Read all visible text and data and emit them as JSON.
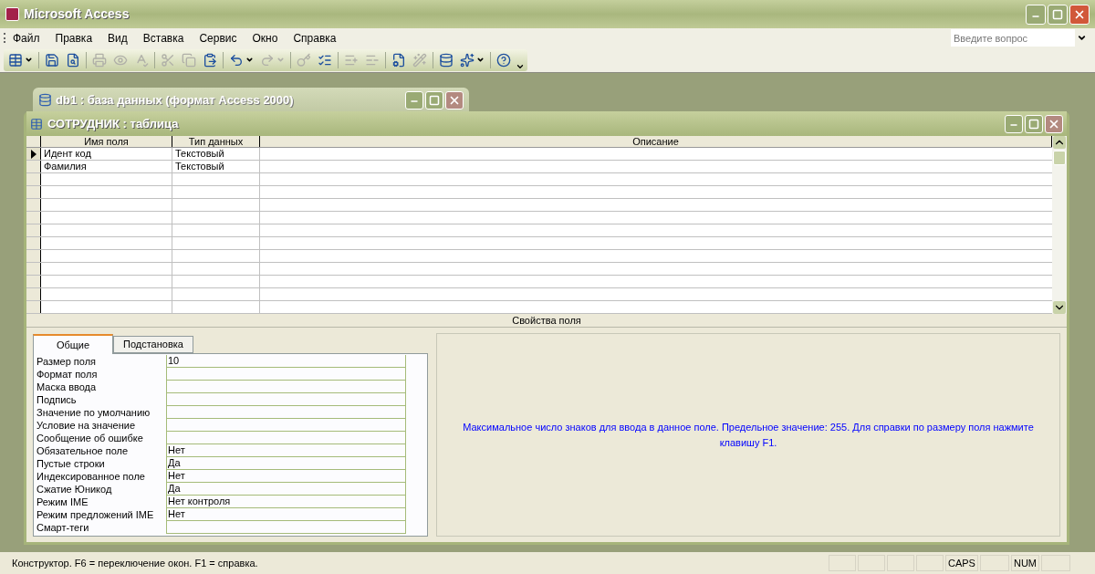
{
  "window": {
    "title": "Microsoft Access"
  },
  "menu": [
    "Файл",
    "Правка",
    "Вид",
    "Вставка",
    "Сервис",
    "Окно",
    "Справка"
  ],
  "question_box": {
    "placeholder": "Введите вопрос"
  },
  "toolbar": [
    {
      "kind": "view",
      "disabled": false
    },
    {
      "kind": "sep"
    },
    {
      "kind": "save",
      "disabled": false
    },
    {
      "kind": "search",
      "disabled": false
    },
    {
      "kind": "sep"
    },
    {
      "kind": "print",
      "disabled": true
    },
    {
      "kind": "preview",
      "disabled": true
    },
    {
      "kind": "spelling",
      "disabled": true
    },
    {
      "kind": "sep"
    },
    {
      "kind": "cut",
      "disabled": true
    },
    {
      "kind": "copy",
      "disabled": true
    },
    {
      "kind": "paste",
      "disabled": false
    },
    {
      "kind": "sep"
    },
    {
      "kind": "undo",
      "disabled": false
    },
    {
      "kind": "redo",
      "disabled": true
    },
    {
      "kind": "sep"
    },
    {
      "kind": "key",
      "disabled": true
    },
    {
      "kind": "builder",
      "disabled": false
    },
    {
      "kind": "sep"
    },
    {
      "kind": "insert_rows",
      "disabled": true
    },
    {
      "kind": "delete_rows",
      "disabled": true
    },
    {
      "kind": "sep"
    },
    {
      "kind": "properties",
      "disabled": false
    },
    {
      "kind": "build",
      "disabled": true
    },
    {
      "kind": "sep"
    },
    {
      "kind": "db_window",
      "disabled": false
    },
    {
      "kind": "new_object",
      "disabled": false
    },
    {
      "kind": "sep"
    },
    {
      "kind": "help",
      "disabled": false
    }
  ],
  "db_window": {
    "title": "db1 : база данных (формат Access 2000)"
  },
  "table_window": {
    "title": "СОТРУДНИК : таблица"
  },
  "design_grid": {
    "columns": [
      "Имя поля",
      "Тип данных",
      "Описание"
    ],
    "rows": [
      {
        "name": "Идент код",
        "type": "Текстовый",
        "selected": true
      },
      {
        "name": "Фамилия",
        "type": "Текстовый",
        "selected": false
      }
    ]
  },
  "field_properties": {
    "title": "Свойства поля",
    "tabs": [
      {
        "label": "Общие",
        "selected": true
      },
      {
        "label": "Подстановка",
        "selected": false
      }
    ],
    "properties": [
      {
        "label": "Размер поля",
        "value": "10"
      },
      {
        "label": "Формат поля"
      },
      {
        "label": "Маска ввода"
      },
      {
        "label": "Подпись"
      },
      {
        "label": "Значение по умолчанию"
      },
      {
        "label": "Условие на значение"
      },
      {
        "label": "Сообщение об ошибке"
      },
      {
        "label": "Обязательное поле",
        "value": "Нет"
      },
      {
        "label": "Пустые строки",
        "value": "Да"
      },
      {
        "label": "Индексированное поле",
        "value": "Нет"
      },
      {
        "label": "Сжатие Юникод",
        "value": "Да"
      },
      {
        "label": "Режим IME",
        "value": "Нет контроля"
      },
      {
        "label": "Режим предложений IME",
        "value": "Нет"
      },
      {
        "label": "Смарт-теги"
      }
    ],
    "help_text": "Максимальное число знаков для ввода в данное поле.  Предельное значение: 255.  Для справки по размеру поля нажмите клавишу F1."
  },
  "status_bar": {
    "message": "Конструктор.  F6 = переключение окон.  F1 = справка.",
    "indicators": [
      "CAPS",
      "NUM"
    ]
  }
}
